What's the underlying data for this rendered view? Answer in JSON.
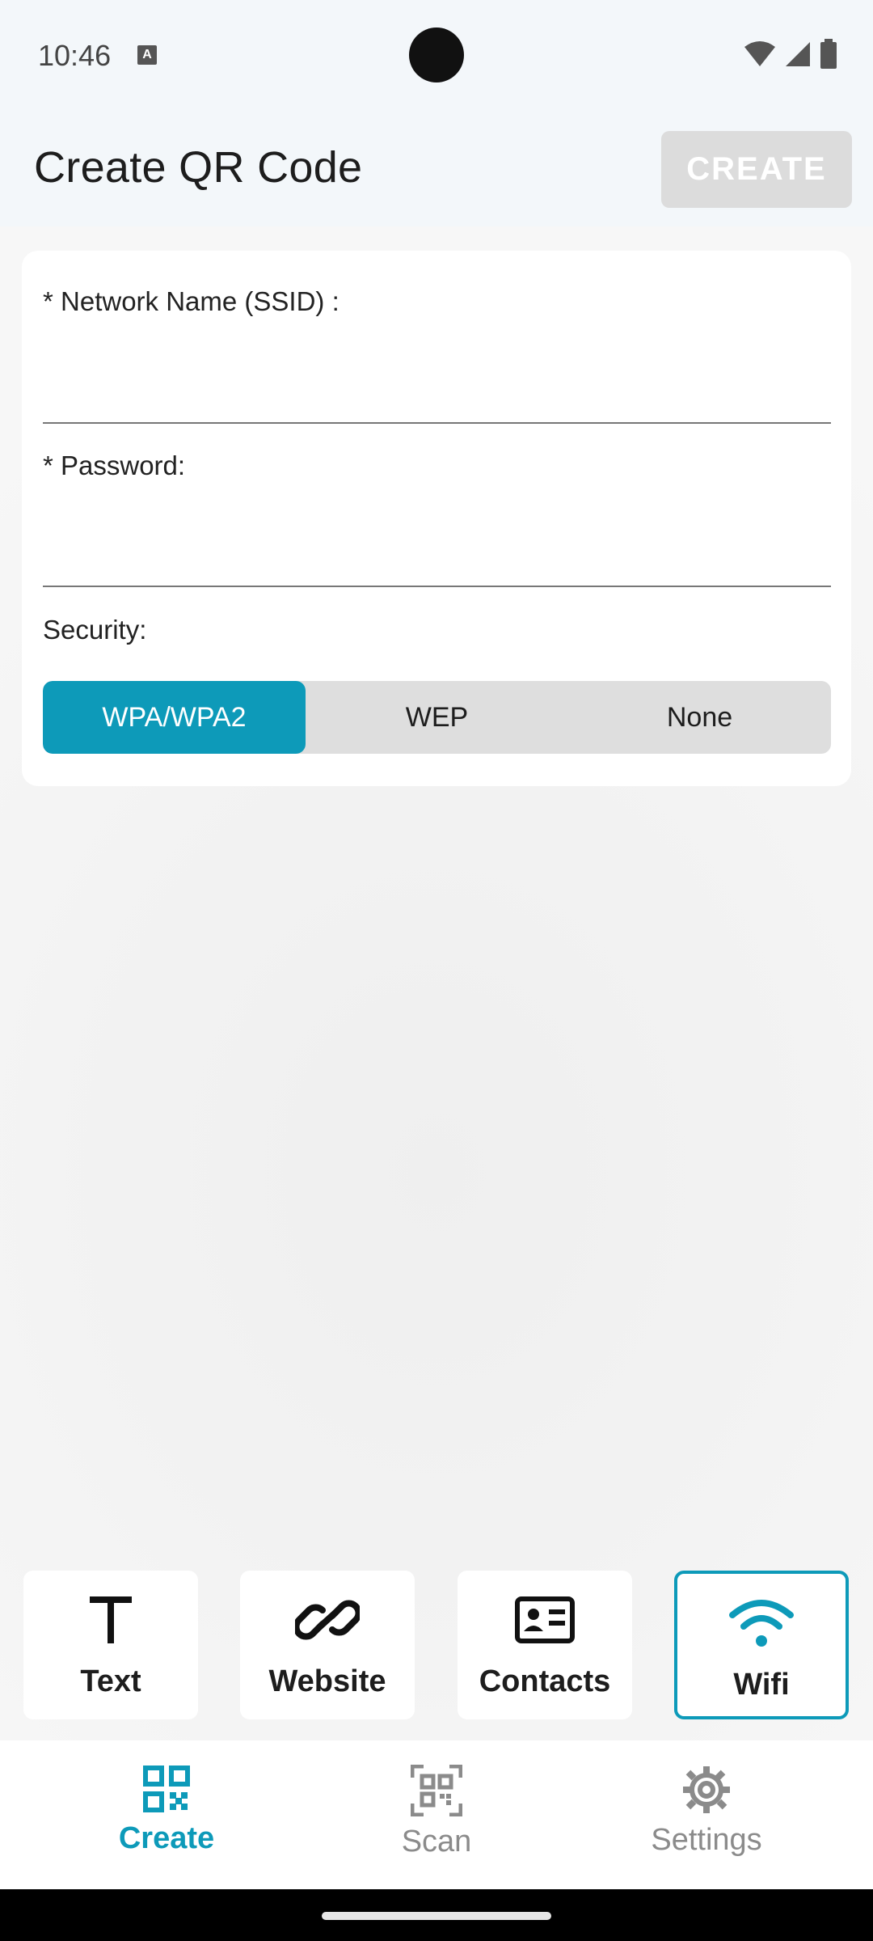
{
  "status_bar": {
    "time": "10:46",
    "notif_icon_letter": "A"
  },
  "app_bar": {
    "title": "Create QR Code",
    "create_label": "CREATE"
  },
  "form": {
    "ssid_label": "* Network Name (SSID) :",
    "ssid_value": "",
    "password_label": "* Password:",
    "password_value": "",
    "security_label": "Security:",
    "security_options": [
      "WPA/WPA2",
      "WEP",
      "None"
    ],
    "security_selected": "WPA/WPA2"
  },
  "types": [
    {
      "label": "Text",
      "icon": "text-icon"
    },
    {
      "label": "Website",
      "icon": "link-icon"
    },
    {
      "label": "Contacts",
      "icon": "contact-card-icon"
    },
    {
      "label": "Wifi",
      "icon": "wifi-icon"
    }
  ],
  "selected_type": "Wifi",
  "bottom_nav": [
    {
      "label": "Create",
      "icon": "qr-grid-icon",
      "active": true
    },
    {
      "label": "Scan",
      "icon": "qr-scan-icon",
      "active": false
    },
    {
      "label": "Settings",
      "icon": "gear-icon",
      "active": false
    }
  ],
  "colors": {
    "accent": "#0d9ab9",
    "disabled_button": "#dcdcdc",
    "segment_bg": "#dedede"
  }
}
